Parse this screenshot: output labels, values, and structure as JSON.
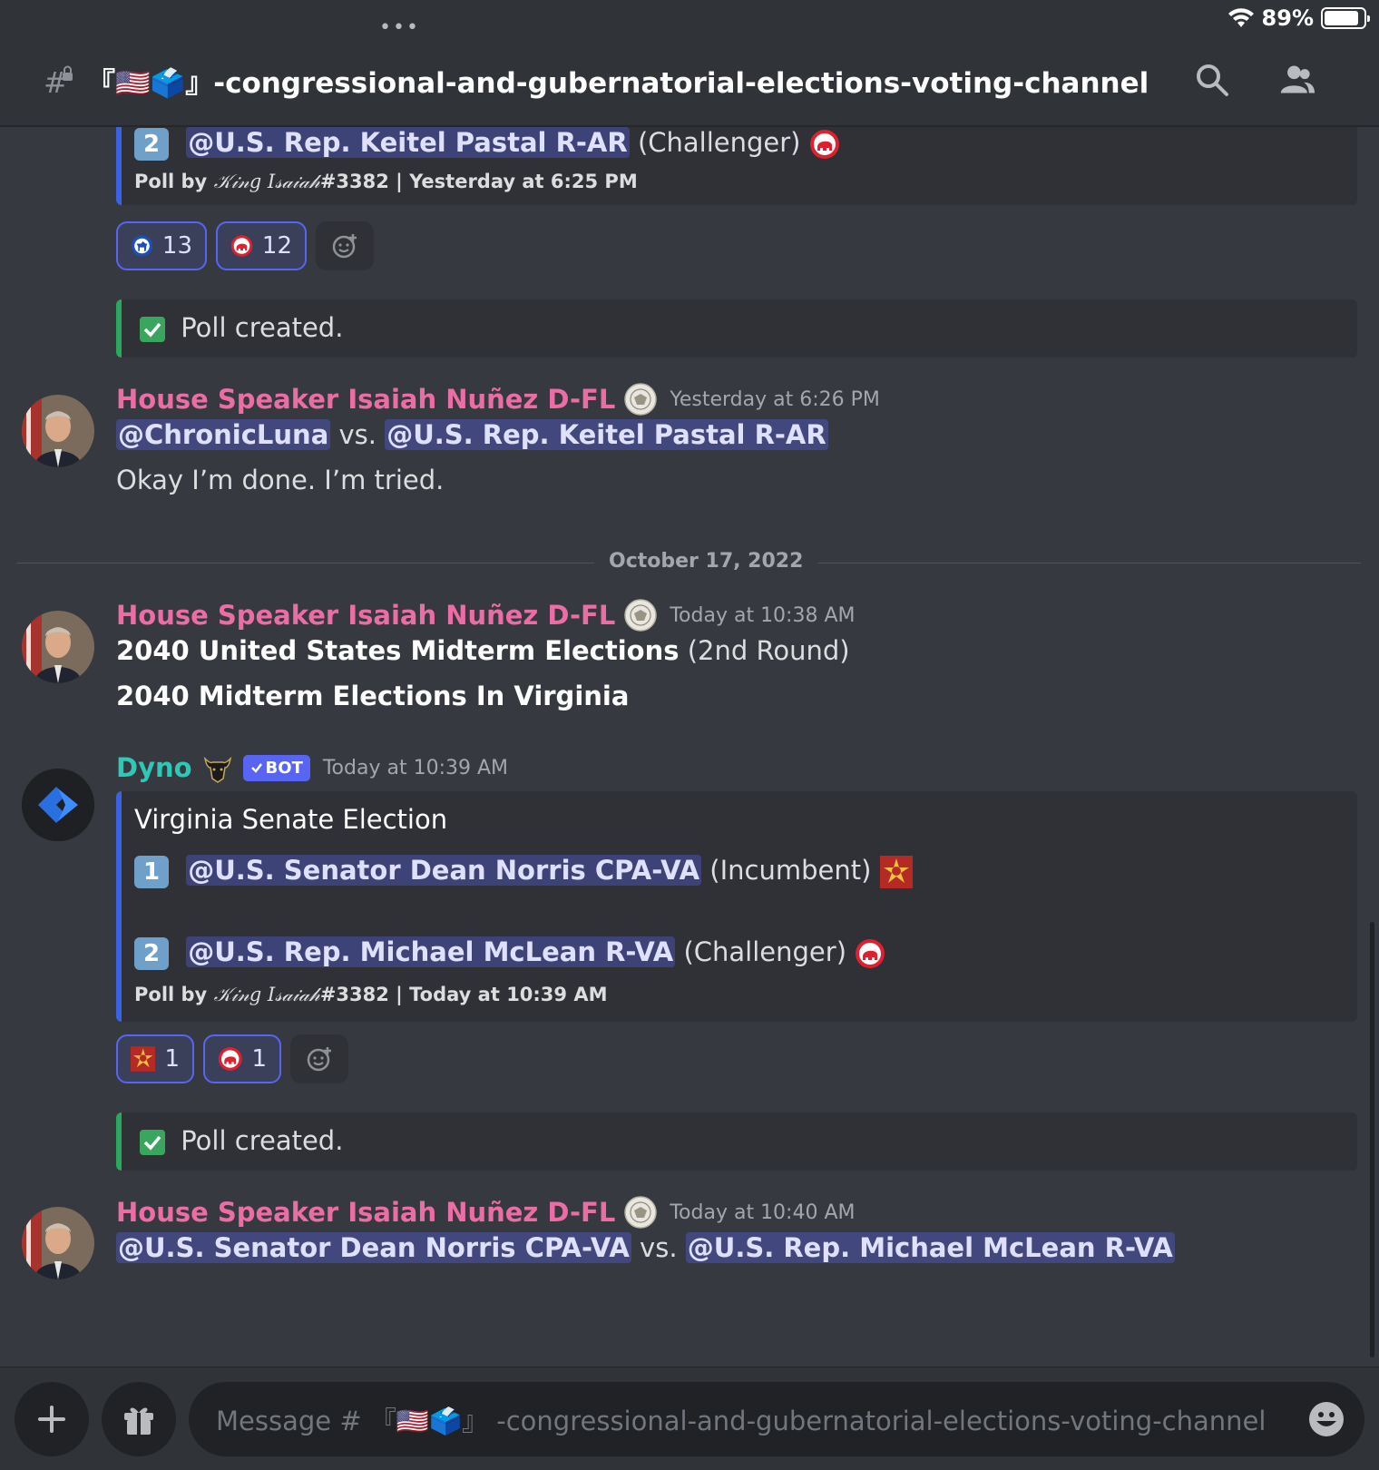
{
  "status_bar": {
    "battery": "89%",
    "battery_level": 0.89,
    "menu_dots": "•••"
  },
  "header": {
    "channel_name": "『🇺🇸🗳️』-congressional-and-gubernatorial-elections-voting-channel"
  },
  "first_poll_tail": {
    "option2_number": "2",
    "option2_mention": "@U.S. Rep. Keitel Pastal R-AR",
    "option2_note": "(Challenger)",
    "footer_prefix": "Poll by ",
    "footer_author": "𝒦𝒾𝓃𝑔 𝐼𝓈𝒶𝒾𝒶𝒽",
    "footer_suffix": "#3382 | Yesterday at 6:25 PM",
    "reactions": [
      {
        "icon": "democrat-donkey-icon",
        "count": "13"
      },
      {
        "icon": "republican-elephant-icon",
        "count": "12"
      }
    ],
    "confirm_text": "Poll created."
  },
  "messages": {
    "m1": {
      "author": "House Speaker Isaiah Nuñez D-FL",
      "time": "Yesterday at 6:26 PM",
      "mention_a": "@ChronicLuna",
      "vs": " vs. ",
      "mention_b": "@U.S. Rep. Keitel Pastal R-AR",
      "line2": "Okay I’m done. I’m tried."
    },
    "date_divider": "October 17, 2022",
    "m2": {
      "author": "House Speaker Isaiah Nuñez D-FL",
      "time": "Today at 10:38 AM",
      "line1_bold": "2040 United States Midterm Elections",
      "line1_rest": " (2nd Round)",
      "line2_bold": "2040 Midterm Elections In Virginia"
    },
    "m3": {
      "author": "Dyno",
      "bot_tag": "BOT",
      "time": "Today at 10:39 AM",
      "embed_title": "Virginia Senate Election",
      "option1_number": "1",
      "option1_mention": "@U.S. Senator Dean Norris CPA-VA",
      "option1_note": "(Incumbent)",
      "option2_number": "2",
      "option2_mention": "@U.S. Rep. Michael McLean R-VA",
      "option2_note": "(Challenger)",
      "footer_prefix": "Poll by ",
      "footer_author": "𝒦𝒾𝓃𝑔 𝐼𝓈𝒶𝒾𝒶𝒽",
      "footer_suffix": "#3382 | Today at 10:39 AM",
      "reactions": [
        {
          "icon": "star-emblem-icon",
          "count": "1"
        },
        {
          "icon": "republican-elephant-icon",
          "count": "1"
        }
      ],
      "confirm_text": "Poll created."
    },
    "m4": {
      "author": "House Speaker Isaiah Nuñez D-FL",
      "time": "Today at 10:40 AM",
      "mention_a": "@U.S. Senator Dean Norris CPA-VA",
      "vs": " vs. ",
      "mention_b": "@U.S. Rep. Michael McLean R-VA"
    }
  },
  "composer": {
    "placeholder": "Message # 『🇺🇸🗳️』 -congressional-and-gubernatorial-elections-voting-channel"
  },
  "colors": {
    "background": "#36393f",
    "username_pink": "#eb6da6",
    "bot_teal": "#2ec9b6",
    "blurple": "#5865f2",
    "embed_border_blue": "#3b62e3",
    "success_green": "#2aa85c",
    "republican_red": "#e0202e"
  }
}
